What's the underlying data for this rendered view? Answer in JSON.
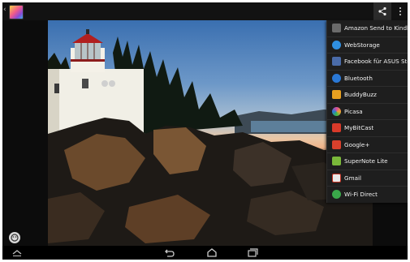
{
  "share_menu": {
    "items": [
      {
        "label": "Amazon Send to Kindle",
        "icon": "kindle-icon",
        "color": "#6b6b6b"
      },
      {
        "label": "WebStorage",
        "icon": "webstorage-icon",
        "color": "#2f8fe0"
      },
      {
        "label": "Facebook für ASUS Story",
        "icon": "facebook-icon",
        "color": "#4a6ba8"
      },
      {
        "label": "Bluetooth",
        "icon": "bluetooth-icon",
        "color": "#2a78d6"
      },
      {
        "label": "BuddyBuzz",
        "icon": "buddybuzz-icon",
        "color": "#e8a020"
      },
      {
        "label": "Picasa",
        "icon": "picasa-icon",
        "color": "#d84b9e"
      },
      {
        "label": "MyBitCast",
        "icon": "mybitcast-icon",
        "color": "#d83a2a"
      },
      {
        "label": "Google+",
        "icon": "googleplus-icon",
        "color": "#d8402c"
      },
      {
        "label": "SuperNote Lite",
        "icon": "supernote-icon",
        "color": "#7ab83a"
      },
      {
        "label": "Gmail",
        "icon": "gmail-icon",
        "color": "#e8e8e8"
      },
      {
        "label": "Wi-Fi Direct",
        "icon": "wifi-direct-icon",
        "color": "#3aa84a"
      }
    ]
  },
  "colors": {
    "background": "#0c0c0c",
    "menu_background": "#1e1e1e"
  }
}
